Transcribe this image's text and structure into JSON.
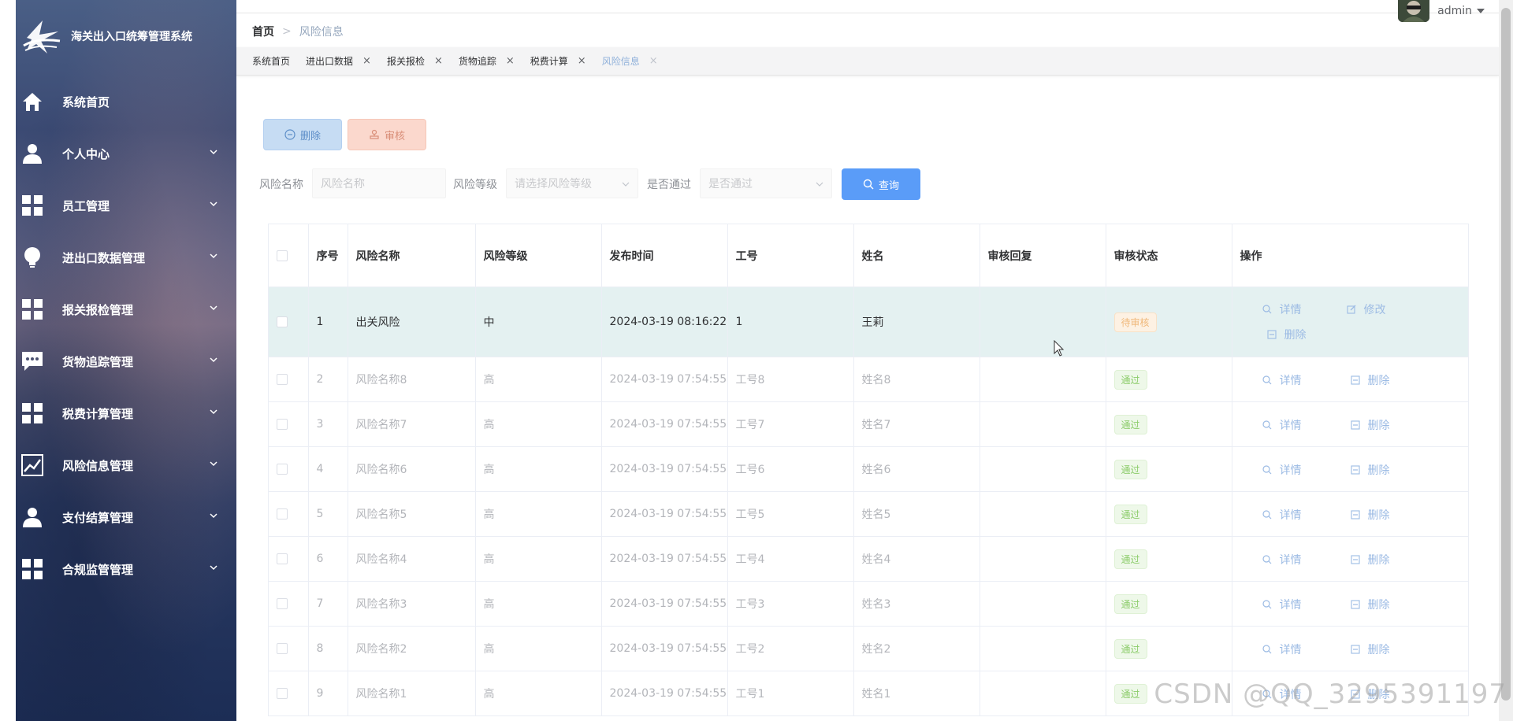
{
  "app": {
    "title": "海关出入口统筹管理系统"
  },
  "sidebar": {
    "items": [
      {
        "label": "系统首页",
        "icon": "home-icon",
        "expandable": false
      },
      {
        "label": "个人中心",
        "icon": "user-icon",
        "expandable": true
      },
      {
        "label": "员工管理",
        "icon": "grid-icon",
        "expandable": true
      },
      {
        "label": "进出口数据管理",
        "icon": "bulb-icon",
        "expandable": true
      },
      {
        "label": "报关报检管理",
        "icon": "grid-icon",
        "expandable": true
      },
      {
        "label": "货物追踪管理",
        "icon": "chat-icon",
        "expandable": true
      },
      {
        "label": "税费计算管理",
        "icon": "grid-icon",
        "expandable": true
      },
      {
        "label": "风险信息管理",
        "icon": "chart-icon",
        "expandable": true
      },
      {
        "label": "支付结算管理",
        "icon": "user-icon",
        "expandable": true
      },
      {
        "label": "合规监管管理",
        "icon": "grid-icon",
        "expandable": true
      }
    ]
  },
  "header": {
    "breadcrumb": {
      "home": "首页",
      "separator": ">",
      "current": "风险信息"
    },
    "user": {
      "name": "admin"
    }
  },
  "tags": [
    {
      "label": "系统首页",
      "closable": false,
      "active": false
    },
    {
      "label": "进出口数据",
      "closable": true,
      "active": false
    },
    {
      "label": "报关报检",
      "closable": true,
      "active": false
    },
    {
      "label": "货物追踪",
      "closable": true,
      "active": false
    },
    {
      "label": "税费计算",
      "closable": true,
      "active": false
    },
    {
      "label": "风险信息",
      "closable": true,
      "active": true
    }
  ],
  "toolbar": {
    "delete_label": "删除",
    "audit_label": "审核",
    "query_label": "查询"
  },
  "filters": {
    "name": {
      "label": "风险名称",
      "placeholder": "风险名称"
    },
    "level": {
      "label": "风险等级",
      "placeholder": "请选择风险等级"
    },
    "passed": {
      "label": "是否通过",
      "placeholder": "是否通过"
    }
  },
  "table": {
    "columns": [
      "序号",
      "风险名称",
      "风险等级",
      "发布时间",
      "工号",
      "姓名",
      "审核回复",
      "审核状态",
      "操作"
    ],
    "rows": [
      {
        "index": "1",
        "name": "出关风险",
        "level": "中",
        "time": "2024-03-19 08:16:22",
        "emp_no": "1",
        "emp_name": "王莉",
        "reply": "",
        "status": "待审核",
        "status_type": "wait",
        "actions": [
          "详情",
          "修改",
          "删除"
        ]
      },
      {
        "index": "2",
        "name": "风险名称8",
        "level": "高",
        "time": "2024-03-19 07:54:55",
        "emp_no": "工号8",
        "emp_name": "姓名8",
        "reply": "",
        "status": "通过",
        "status_type": "pass",
        "actions": [
          "详情",
          "删除"
        ]
      },
      {
        "index": "3",
        "name": "风险名称7",
        "level": "高",
        "time": "2024-03-19 07:54:55",
        "emp_no": "工号7",
        "emp_name": "姓名7",
        "reply": "",
        "status": "通过",
        "status_type": "pass",
        "actions": [
          "详情",
          "删除"
        ]
      },
      {
        "index": "4",
        "name": "风险名称6",
        "level": "高",
        "time": "2024-03-19 07:54:55",
        "emp_no": "工号6",
        "emp_name": "姓名6",
        "reply": "",
        "status": "通过",
        "status_type": "pass",
        "actions": [
          "详情",
          "删除"
        ]
      },
      {
        "index": "5",
        "name": "风险名称5",
        "level": "高",
        "time": "2024-03-19 07:54:55",
        "emp_no": "工号5",
        "emp_name": "姓名5",
        "reply": "",
        "status": "通过",
        "status_type": "pass",
        "actions": [
          "详情",
          "删除"
        ]
      },
      {
        "index": "6",
        "name": "风险名称4",
        "level": "高",
        "time": "2024-03-19 07:54:55",
        "emp_no": "工号4",
        "emp_name": "姓名4",
        "reply": "",
        "status": "通过",
        "status_type": "pass",
        "actions": [
          "详情",
          "删除"
        ]
      },
      {
        "index": "7",
        "name": "风险名称3",
        "level": "高",
        "time": "2024-03-19 07:54:55",
        "emp_no": "工号3",
        "emp_name": "姓名3",
        "reply": "",
        "status": "通过",
        "status_type": "pass",
        "actions": [
          "详情",
          "删除"
        ]
      },
      {
        "index": "8",
        "name": "风险名称2",
        "level": "高",
        "time": "2024-03-19 07:54:55",
        "emp_no": "工号2",
        "emp_name": "姓名2",
        "reply": "",
        "status": "通过",
        "status_type": "pass",
        "actions": [
          "详情",
          "删除"
        ]
      },
      {
        "index": "9",
        "name": "风险名称1",
        "level": "高",
        "time": "2024-03-19 07:54:55",
        "emp_no": "工号1",
        "emp_name": "姓名1",
        "reply": "",
        "status": "通过",
        "status_type": "pass",
        "actions": [
          "详情",
          "删除"
        ]
      }
    ]
  },
  "watermark": "CSDN @QQ_3295391197",
  "colors": {
    "primary": "#5a9cf8",
    "link": "#9cbbe4",
    "pass": "#8ccc6a",
    "wait": "#f0b87a",
    "highlight_row": "#e4f1f1"
  }
}
